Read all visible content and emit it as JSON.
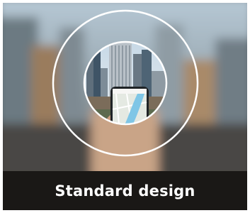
{
  "card": {
    "caption": "Standard design"
  },
  "icons": {
    "lens": "magnifier-ring-icon",
    "phone": "smartphone-icon",
    "map": "map-icon"
  },
  "colors": {
    "caption_bg": "#1a1816",
    "caption_text": "#ffffff",
    "ring": "#ffffff",
    "map_route": "#7fc6e6"
  }
}
